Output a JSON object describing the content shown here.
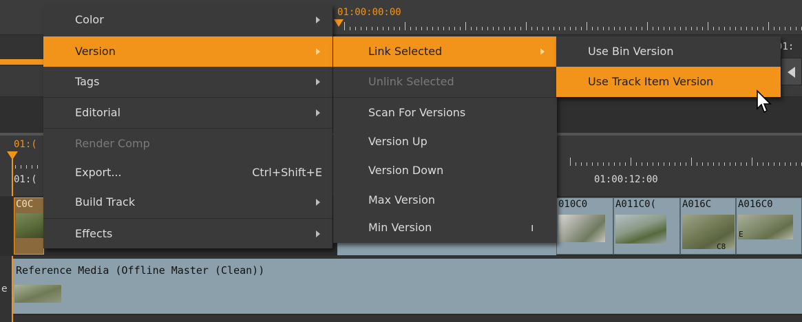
{
  "timeline": {
    "top_timecode": "01:00:00:00",
    "tc_partial_right": "01:",
    "left_tc_top": "01:(",
    "left_tc_bottom": "01:(",
    "mid_timecode": "01:00:12:00",
    "track_clips": [
      {
        "label": "C0C"
      },
      {
        "label": "010C0"
      },
      {
        "label": "A011C0("
      },
      {
        "label": "A016C"
      },
      {
        "label": "A016C0"
      }
    ],
    "reference_track_label": "Reference Media (Offline Master (Clean))",
    "partial_glyph": "e",
    "clip_overlay_c8": "C8",
    "clip_overlay_e": "E"
  },
  "menu_main": {
    "items": [
      {
        "label": "Color",
        "submenu": true,
        "enabled": true
      },
      {
        "label": "Version",
        "submenu": true,
        "enabled": true,
        "highlighted": true
      },
      {
        "label": "Tags",
        "submenu": true,
        "enabled": true
      },
      {
        "label": "Editorial",
        "submenu": true,
        "enabled": true
      },
      {
        "label": "Render Comp",
        "enabled": false
      },
      {
        "label": "Export...",
        "shortcut": "Ctrl+Shift+E",
        "enabled": true
      },
      {
        "label": "Build Track",
        "submenu": true,
        "enabled": true
      },
      {
        "label": "Effects",
        "submenu": true,
        "enabled": true
      }
    ]
  },
  "menu_version": {
    "items": [
      {
        "label": "Link Selected",
        "submenu": true,
        "enabled": true,
        "highlighted": true
      },
      {
        "label": "Unlink Selected",
        "enabled": false
      },
      {
        "label": "Scan For Versions",
        "enabled": true
      },
      {
        "label": "Version Up",
        "enabled": true
      },
      {
        "label": "Version Down",
        "enabled": true
      },
      {
        "label": "Max Version",
        "enabled": true
      },
      {
        "label": "Min Version",
        "enabled": true
      }
    ],
    "trailing_glyph": "ı"
  },
  "menu_link": {
    "items": [
      {
        "label": "Use Bin Version",
        "enabled": true
      },
      {
        "label": "Use Track Item Version",
        "enabled": true,
        "highlighted": true
      }
    ]
  },
  "colors": {
    "accent": "#f2941a",
    "menu_bg": "#3a3a3a",
    "clip_bg": "#8ba0ab"
  }
}
